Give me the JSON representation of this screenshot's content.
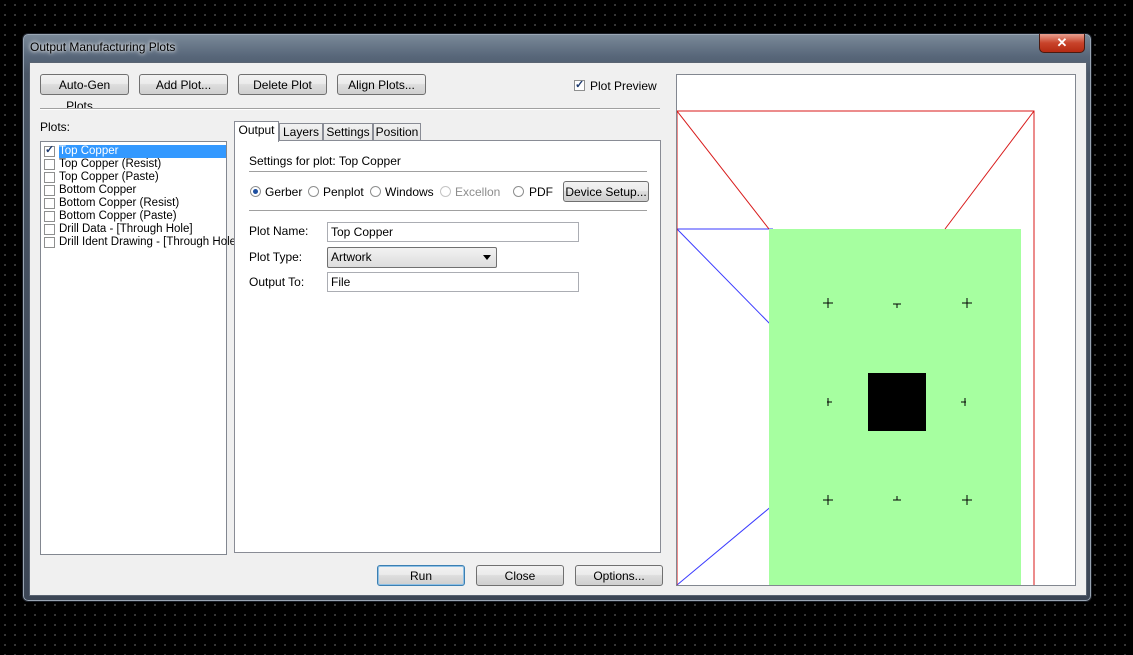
{
  "window": {
    "title": "Output Manufacturing Plots",
    "close_glyph": "✕"
  },
  "toolbar": {
    "auto_gen": "Auto-Gen Plots...",
    "add_plot": "Add Plot...",
    "delete_plot": "Delete Plot",
    "align_plots": "Align Plots...",
    "plot_preview_label": "Plot Preview",
    "plot_preview_checked": true
  },
  "plots": {
    "label": "Plots:",
    "items": [
      {
        "label": "Top Copper",
        "checked": true,
        "selected": true
      },
      {
        "label": "Top Copper (Resist)",
        "checked": false
      },
      {
        "label": "Top Copper (Paste)",
        "checked": false
      },
      {
        "label": "Bottom Copper",
        "checked": false
      },
      {
        "label": "Bottom Copper (Resist)",
        "checked": false
      },
      {
        "label": "Bottom Copper (Paste)",
        "checked": false
      },
      {
        "label": "Drill Data - [Through Hole]",
        "checked": false
      },
      {
        "label": "Drill Ident Drawing - [Through Hole",
        "checked": false
      }
    ]
  },
  "tabs": [
    "Output",
    "Layers",
    "Settings",
    "Position"
  ],
  "output": {
    "settings_for": "Settings for plot: Top Copper",
    "formats": [
      {
        "label": "Gerber",
        "selected": true,
        "enabled": true
      },
      {
        "label": "Penplot",
        "selected": false,
        "enabled": true
      },
      {
        "label": "Windows",
        "selected": false,
        "enabled": true
      },
      {
        "label": "Excellon",
        "selected": false,
        "enabled": false
      },
      {
        "label": "PDF",
        "selected": false,
        "enabled": true
      }
    ],
    "device_setup": "Device Setup...",
    "plot_name_label": "Plot Name:",
    "plot_name_value": "Top Copper",
    "plot_type_label": "Plot Type:",
    "plot_type_value": "Artwork",
    "output_to_label": "Output To:",
    "output_to_value": "File"
  },
  "footer": {
    "run": "Run",
    "close": "Close",
    "options": "Options..."
  },
  "colors": {
    "board": "#a6ffa0",
    "outline": "#d81a1a",
    "guide": "#3a3aff",
    "selection": "#3399ff"
  }
}
